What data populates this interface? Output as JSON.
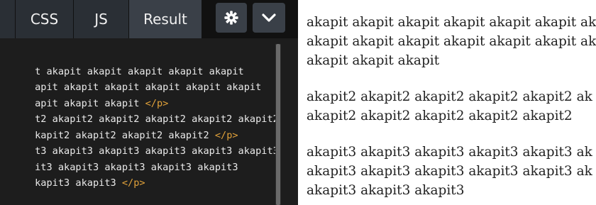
{
  "tabs": [
    {
      "label": "CSS"
    },
    {
      "label": "JS"
    },
    {
      "label": "Result"
    }
  ],
  "toolbar": {
    "settings_icon": "gear-icon",
    "dropdown_icon": "chevron-down-icon"
  },
  "editor": {
    "lines": [
      {
        "text": "t akapit akapit akapit akapit akapit",
        "tag": ""
      },
      {
        "text": "apit akapit akapit akapit akapit akapit",
        "tag": ""
      },
      {
        "text": "apit akapit akapit ",
        "tag": "</p>"
      },
      {
        "text": "t2 akapit2 akapit2 akapit2 akapit2 akapit2",
        "tag": ""
      },
      {
        "text": "kapit2 akapit2 akapit2 akapit2 ",
        "tag": "</p>"
      },
      {
        "text": "t3 akapit3 akapit3 akapit3 akapit3 akapit3",
        "tag": ""
      },
      {
        "text": "it3 akapit3 akapit3 akapit3 akapit3",
        "tag": ""
      },
      {
        "text": "kapit3 akapit3 ",
        "tag": "</p>"
      }
    ]
  },
  "result": {
    "paragraphs": [
      {
        "lines": [
          "akapit akapit akapit akapit akapit akapit ak",
          "akapit akapit akapit akapit akapit akapit ak",
          "akapit akapit akapit"
        ]
      },
      {
        "lines": [
          "akapit2 akapit2 akapit2 akapit2 akapit2 ak",
          "akapit2 akapit2 akapit2 akapit2 akapit2"
        ]
      },
      {
        "lines": [
          "akapit3 akapit3 akapit3 akapit3 akapit3 ak",
          "akapit3 akapit3 akapit3 akapit3 akapit3 ak",
          "akapit3 akapit3 akapit3"
        ]
      }
    ]
  }
}
